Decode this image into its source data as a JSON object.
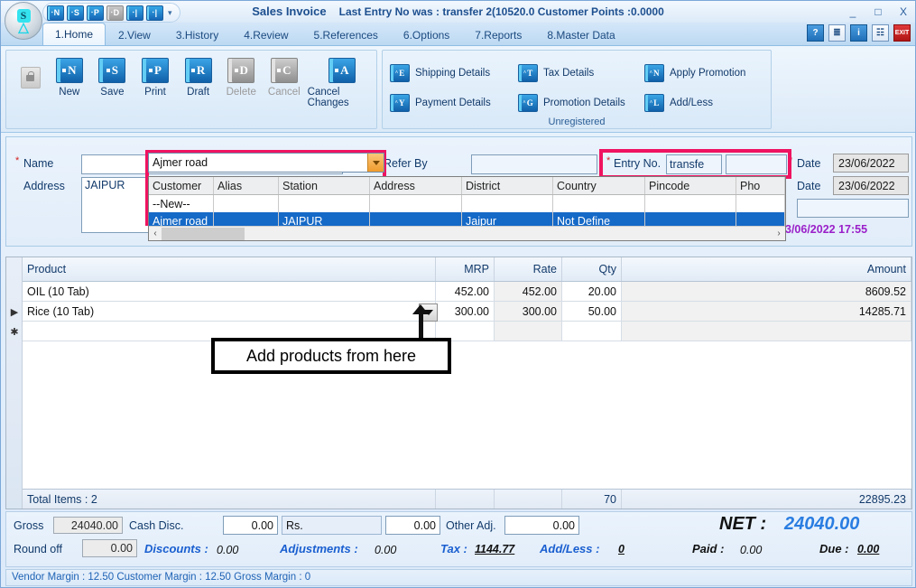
{
  "window": {
    "title": "Sales Invoice",
    "subtitle": "Last Entry No was : transfer 2(10520.0  Customer Points :0.0000",
    "minimize": "_",
    "maximize": "□",
    "close": "X",
    "quick_access": [
      {
        "name": "new",
        "letter": "N",
        "enabled": true
      },
      {
        "name": "save",
        "letter": "S",
        "enabled": true
      },
      {
        "name": "print",
        "letter": "P",
        "enabled": true
      },
      {
        "name": "draft",
        "letter": "D",
        "enabled": false
      },
      {
        "name": "item1",
        "letter": "|",
        "enabled": true
      },
      {
        "name": "item2",
        "letter": "|",
        "enabled": true
      }
    ],
    "qat_more": "▾"
  },
  "tabs": [
    {
      "label": "1.Home",
      "active": true
    },
    {
      "label": "2.View",
      "active": false
    },
    {
      "label": "3.History",
      "active": false
    },
    {
      "label": "4.Review",
      "active": false
    },
    {
      "label": "5.References",
      "active": false
    },
    {
      "label": "6.Options",
      "active": false
    },
    {
      "label": "7.Reports",
      "active": false
    },
    {
      "label": "8.Master Data",
      "active": false
    }
  ],
  "top_icons": [
    {
      "name": "help-icon",
      "glyph": "?"
    },
    {
      "name": "printer-icon",
      "glyph": "≣"
    },
    {
      "name": "info-icon",
      "glyph": "i"
    },
    {
      "name": "document-icon",
      "glyph": "☷"
    },
    {
      "name": "exit-icon",
      "glyph": "EXIT"
    }
  ],
  "ribbon": {
    "group1_buttons": [
      {
        "label": "New",
        "letter": "N",
        "enabled": true
      },
      {
        "label": "Save",
        "letter": "S",
        "enabled": true
      },
      {
        "label": "Print",
        "letter": "P",
        "enabled": true
      },
      {
        "label": "Draft",
        "letter": "R",
        "enabled": true
      },
      {
        "label": "Delete",
        "letter": "D",
        "enabled": false
      },
      {
        "label": "Cancel",
        "letter": "C",
        "enabled": false
      },
      {
        "label": "Cancel Changes",
        "letter": "A",
        "enabled": true
      }
    ],
    "group2_buttons": [
      {
        "label": "Shipping Details",
        "shortcut": "^",
        "letter": "E"
      },
      {
        "label": "Tax Details",
        "shortcut": "^",
        "letter": "T"
      },
      {
        "label": "Apply Promotion",
        "shortcut": "^",
        "letter": "N"
      },
      {
        "label": "Payment Details",
        "shortcut": "^",
        "letter": "Y"
      },
      {
        "label": "Promotion Details",
        "shortcut": "^",
        "letter": "G"
      },
      {
        "label": "Add/Less",
        "shortcut": "^",
        "letter": "L"
      }
    ],
    "group2_caption": "Unregistered"
  },
  "form": {
    "name_label": "Name",
    "name_required": "*",
    "name_value": "",
    "address_label": "Address",
    "address_value": "JAIPUR",
    "refer_by_label": "Refer By",
    "refer_by_value": "",
    "entry_no_label": "Entry No.",
    "entry_no_required": "*",
    "entry_no_value": "transfe",
    "entry_no_second_value": "",
    "entry_no_second_required": "*",
    "date_label": "Date",
    "date_value": "23/06/2022",
    "date2_label": "Date",
    "date2_value": "23/06/2022",
    "extra_select_value": "",
    "timestamp": "3/06/2022 17:55"
  },
  "autocomplete": {
    "input_value": "Ajmer road",
    "columns": [
      "Customer",
      "Alias",
      "Station",
      "Address",
      "District",
      "Country",
      "Pincode",
      "Pho"
    ],
    "rows": [
      {
        "cells": [
          "--New--",
          "",
          "",
          "",
          "",
          "",
          "",
          ""
        ],
        "selected": false
      },
      {
        "cells": [
          "Ajmer road",
          "",
          "JAIPUR",
          "",
          "Jaipur",
          "Not Define",
          "",
          ""
        ],
        "selected": true
      }
    ],
    "scroll_left": "‹",
    "scroll_right": "›"
  },
  "product_grid": {
    "columns": [
      "Product",
      "MRP",
      "Rate",
      "Qty",
      "Amount"
    ],
    "rows": [
      {
        "marker": "",
        "product": "OIL (10 Tab)",
        "mrp": "452.00",
        "rate": "452.00",
        "qty": "20.00",
        "amount": "8609.52"
      },
      {
        "marker": "▶",
        "product": "Rice (10 Tab)",
        "mrp": "300.00",
        "rate": "300.00",
        "qty": "50.00",
        "amount": "14285.71"
      },
      {
        "marker": "✱",
        "product": "",
        "mrp": "",
        "rate": "",
        "qty": "",
        "amount": ""
      }
    ],
    "summary": {
      "label": "Total Items : 2",
      "qty": "70",
      "amount": "22895.23"
    }
  },
  "callout": {
    "text": "Add products from here"
  },
  "totals": {
    "gross_label": "Gross",
    "gross_value": "24040.00",
    "cash_disc_label": "Cash Disc.",
    "cash_disc_value": "0.00",
    "currency_value": "Rs.",
    "currency_amount": "0.00",
    "other_adj_label": "Other Adj.",
    "other_adj_value": "0.00",
    "round_off_label": "Round off",
    "round_off_value": "0.00",
    "discounts_label": "Discounts :",
    "discounts_value": "0.00",
    "adjustments_label": "Adjustments :",
    "adjustments_value": "0.00",
    "tax_label": "Tax :",
    "tax_value": "1144.77",
    "addless_label": "Add/Less :",
    "addless_value": "0",
    "net_label": "NET :",
    "net_value": "24040.00",
    "paid_label": "Paid :",
    "paid_value": "0.00",
    "due_label": "Due :",
    "due_value": "0.00"
  },
  "status_bar": {
    "text": "Vendor Margin : 12.50 Customer Margin : 12.50 Gross Margin : 0"
  },
  "colors": {
    "highlight_pink": "#ef1360",
    "selection_blue": "#1569c7",
    "net_blue": "#2a7de1",
    "timestamp_purple": "#9b1fc9",
    "title_blue": "#1d4f8f"
  }
}
